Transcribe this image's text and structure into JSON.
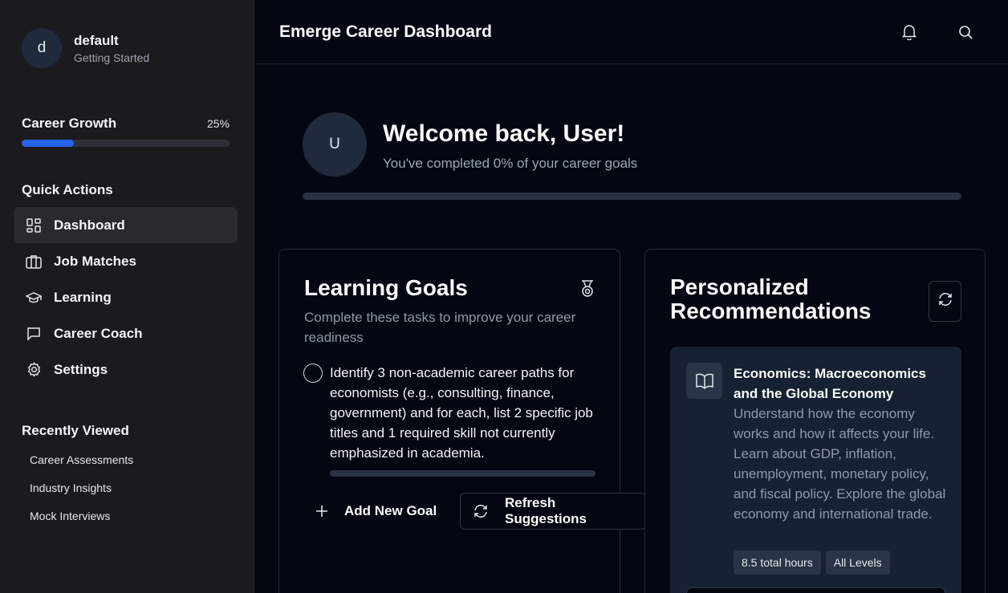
{
  "user": {
    "avatar_initial": "d",
    "name": "default",
    "status": "Getting Started"
  },
  "growth": {
    "label": "Career Growth",
    "percent_text": "25%",
    "progress": 0.25
  },
  "quick_actions": {
    "title": "Quick Actions",
    "items": [
      {
        "label": "Dashboard",
        "icon": "dashboard-icon",
        "active": true
      },
      {
        "label": "Job Matches",
        "icon": "briefcase-icon"
      },
      {
        "label": "Learning",
        "icon": "graduation-cap-icon"
      },
      {
        "label": "Career Coach",
        "icon": "chat-bubble-icon"
      },
      {
        "label": "Settings",
        "icon": "gear-icon"
      }
    ]
  },
  "recently_viewed": {
    "title": "Recently Viewed",
    "items": [
      "Career Assessments",
      "Industry Insights",
      "Mock Interviews"
    ]
  },
  "header": {
    "title": "Emerge Career Dashboard",
    "icons": [
      "bell-icon",
      "search-icon"
    ]
  },
  "welcome": {
    "avatar_initial": "U",
    "heading": "Welcome back, User!",
    "subtitle": "You've completed 0% of your career goals",
    "progress": 0
  },
  "learning_goals": {
    "title": "Learning Goals",
    "description": "Complete these tasks to improve your career readiness",
    "goals": [
      {
        "text": "Identify 3 non-academic career paths for economists (e.g., consulting, finance, government) and for each, list 2 specific job titles and 1 required skill not currently emphasized in academia.",
        "completed": false,
        "progress": 0
      }
    ],
    "add_label": "Add New Goal",
    "refresh_label": "Refresh Suggestions"
  },
  "recommendations": {
    "title": "Personalized Recommendations",
    "courses": [
      {
        "title": "Economics: Macroeconomics and the Global Economy",
        "description": "Understand how the economy works and how it affects your life. Learn about GDP, inflation, unemployment, monetary policy, and fiscal policy. Explore the global economy and international trade.",
        "tags": [
          "8.5 total hours",
          "All Levels"
        ]
      }
    ]
  },
  "colors": {
    "accent": "#2563eb",
    "sidebar_bg": "#1b1b1d",
    "main_bg": "#030712",
    "card_inner_bg": "#172131"
  }
}
